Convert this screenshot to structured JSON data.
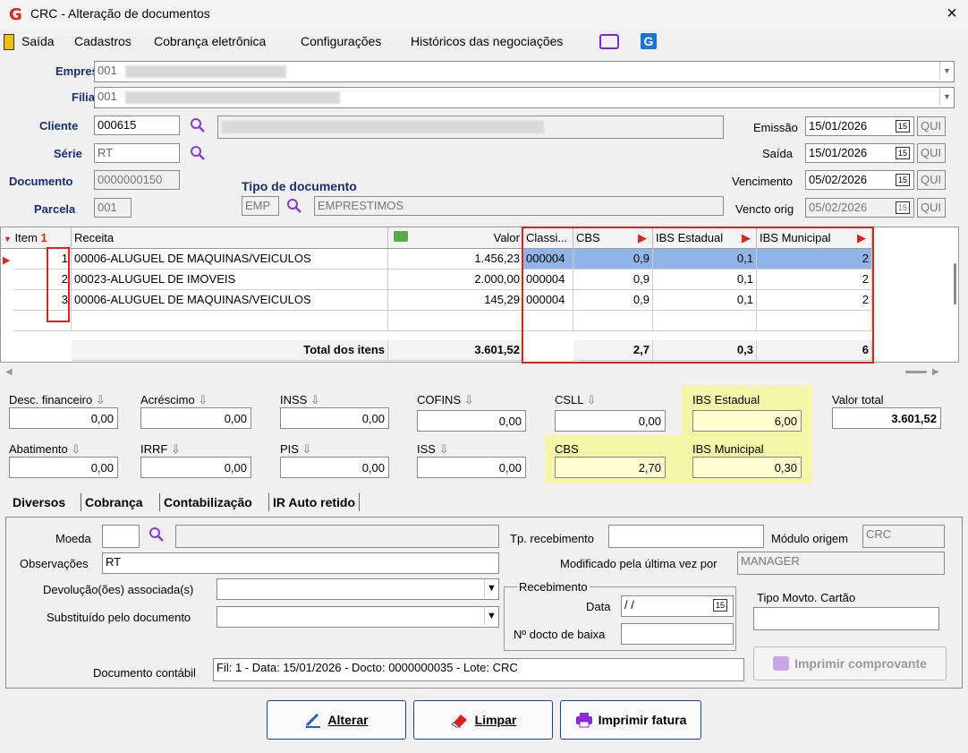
{
  "window": {
    "title": "CRC - Alteração de documentos",
    "close": "×",
    "logo": "G"
  },
  "menu": [
    {
      "label": "Saída"
    },
    {
      "label": "Cadastros"
    },
    {
      "label": "Cobrança eletrônica"
    },
    {
      "label": "Configurações"
    },
    {
      "label": "Históricos das negociações"
    }
  ],
  "header": {
    "empresa_label": "Empresa",
    "empresa_value": "001",
    "filial_label": "Filial",
    "filial_value": "001",
    "cliente_label": "Cliente",
    "cliente_value": "000615",
    "serie_label": "Série",
    "serie_value": "RT",
    "documento_label": "Documento",
    "documento_value": "0000000150",
    "parcela_label": "Parcela",
    "parcela_value": "001",
    "tipo_doc_label": "Tipo de documento",
    "tipo_doc_code": "EMP",
    "tipo_doc_desc": "EMPRESTIMOS",
    "emissao_label": "Emissão",
    "emissao_value": "15/01/2026",
    "emissao_day": "QUI",
    "saida_label": "Saída",
    "saida_value": "15/01/2026",
    "saida_day": "QUI",
    "vencimento_label": "Vencimento",
    "vencimento_value": "05/02/2026",
    "vencimento_day": "QUI",
    "vencto_orig_label": "Vencto orig",
    "vencto_orig_value": "05/02/2026",
    "vencto_orig_day": "QUI"
  },
  "grid": {
    "columns": {
      "item": "Item",
      "sort": "1",
      "receita": "Receita",
      "valor": "Valor",
      "classi": "Classi...",
      "cbs": "CBS",
      "ibs_est": "IBS Estadual",
      "ibs_mun": "IBS Municipal"
    },
    "rows": [
      {
        "item": "1",
        "receita": "00006-ALUGUEL DE MAQUINAS/VEICULOS",
        "valor": "1.456,23",
        "classi": "000004",
        "cbs": "0,9",
        "ibs_est": "0,1",
        "ibs_mun": "2"
      },
      {
        "item": "2",
        "receita": "00023-ALUGUEL DE IMOVEIS",
        "valor": "2.000,00",
        "classi": "000004",
        "cbs": "0,9",
        "ibs_est": "0,1",
        "ibs_mun": "2"
      },
      {
        "item": "3",
        "receita": "00006-ALUGUEL DE MAQUINAS/VEICULOS",
        "valor": "145,29",
        "classi": "000004",
        "cbs": "0,9",
        "ibs_est": "0,1",
        "ibs_mun": "2"
      }
    ],
    "total_label": "Total dos itens",
    "total_valor": "3.601,52",
    "total_cbs": "2,7",
    "total_ibs_est": "0,3",
    "total_ibs_mun": "6"
  },
  "totals": {
    "desc_fin_label": "Desc. financeiro",
    "desc_fin": "0,00",
    "acrescimo_label": "Acréscimo",
    "acrescimo": "0,00",
    "inss_label": "INSS",
    "inss": "0,00",
    "cofins_label": "COFINS",
    "cofins": "0,00",
    "csll_label": "CSLL",
    "csll": "0,00",
    "ibs_est_label": "IBS Estadual",
    "ibs_est": "6,00",
    "valor_total_label": "Valor total",
    "valor_total": "3.601,52",
    "abatimento_label": "Abatimento",
    "abatimento": "0,00",
    "irrf_label": "IRRF",
    "irrf": "0,00",
    "pis_label": "PIS",
    "pis": "0,00",
    "iss_label": "ISS",
    "iss": "0,00",
    "cbs_label": "CBS",
    "cbs": "2,70",
    "ibs_mun_label": "IBS Municipal",
    "ibs_mun": "0,30"
  },
  "tabs": [
    "Diversos",
    "Cobrança",
    "Contabilização",
    "IR Auto retido"
  ],
  "diversos": {
    "moeda_label": "Moeda",
    "obs_label": "Observações",
    "obs_value": "RT",
    "devol_label": "Devolução(ões) associada(s)",
    "subst_label": "Substituído pelo documento",
    "tp_receb_label": "Tp. recebimento",
    "modulo_label": "Módulo origem",
    "modulo_value": "CRC",
    "modificado_label": "Modificado pela última vez por",
    "modificado_value": "MANAGER",
    "recebimento_label": "Recebimento",
    "data_label": "Data",
    "data_value": "/ /",
    "ndocto_label": "Nº docto de baixa",
    "tipo_movto_label": "Tipo Movto. Cartão",
    "imprimir_comp_label": "Imprimir comprovante",
    "doc_contabil_label": "Documento contábil",
    "doc_contabil_value": "Fil: 1 - Data: 15/01/2026 - Docto: 0000000035 - Lote: CRC"
  },
  "buttons": {
    "alterar": "Alterar",
    "limpar": "Limpar",
    "imprimir": "Imprimir fatura"
  },
  "colors": {
    "highlight_red": "#d22222",
    "selected_row": "#8fb4e6",
    "yellow": "#f5f5a8",
    "label_blue": "#1a2e6e"
  }
}
